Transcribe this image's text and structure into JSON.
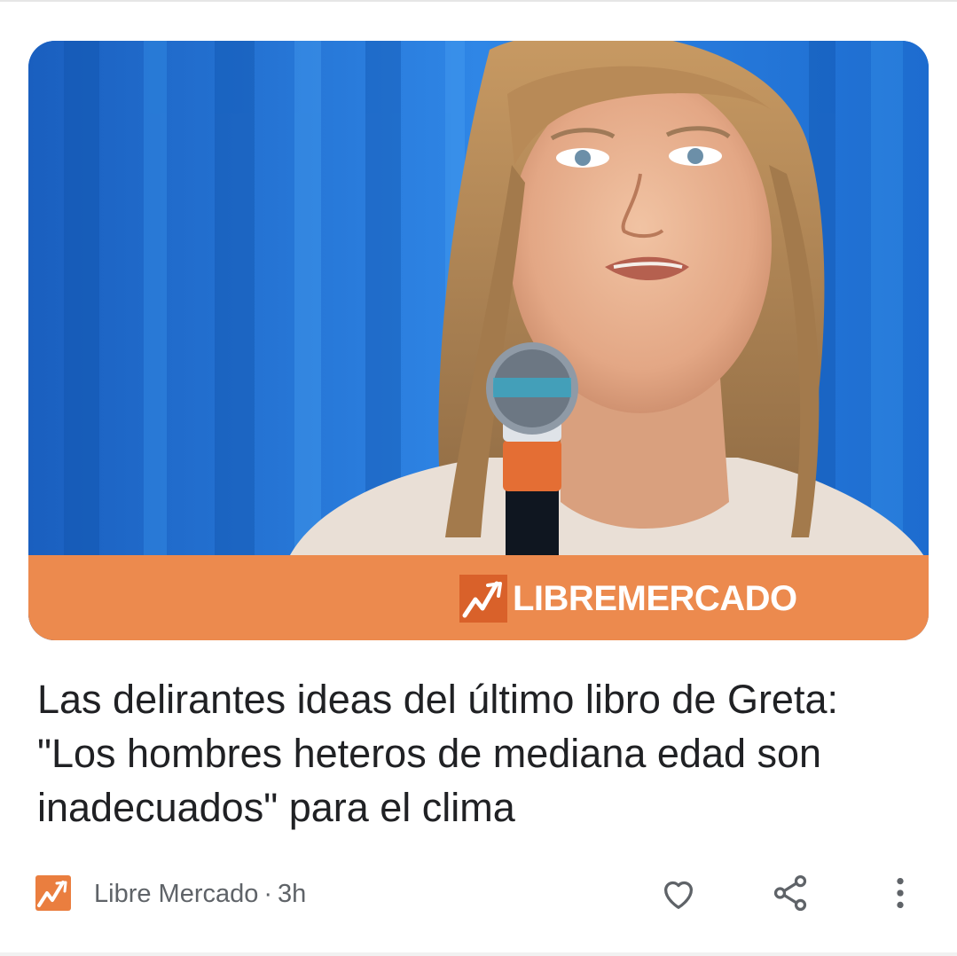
{
  "article": {
    "image": {
      "alt": "Greta Thunberg speaking into a microphone",
      "brand_band_text": "LIBREMERCADO",
      "brand_color": "#ec8a4e",
      "icon": "libremercado-logo-icon"
    },
    "headline": "Las delirantes ideas del último libro de Greta: \"Los hombres heteros de mediana edad son inadecuados\" para el clima",
    "source": {
      "name": "Libre Mercado",
      "separator": "·",
      "age": "3h",
      "icon": "libremercado-source-icon"
    },
    "actions": {
      "like_icon": "heart-icon",
      "share_icon": "share-icon",
      "more_icon": "more-vertical-icon"
    }
  },
  "colors": {
    "text_primary": "#202124",
    "text_secondary": "#5f6368",
    "brand_orange": "#ec8a4e",
    "hero_background": "#1f6fd1"
  }
}
